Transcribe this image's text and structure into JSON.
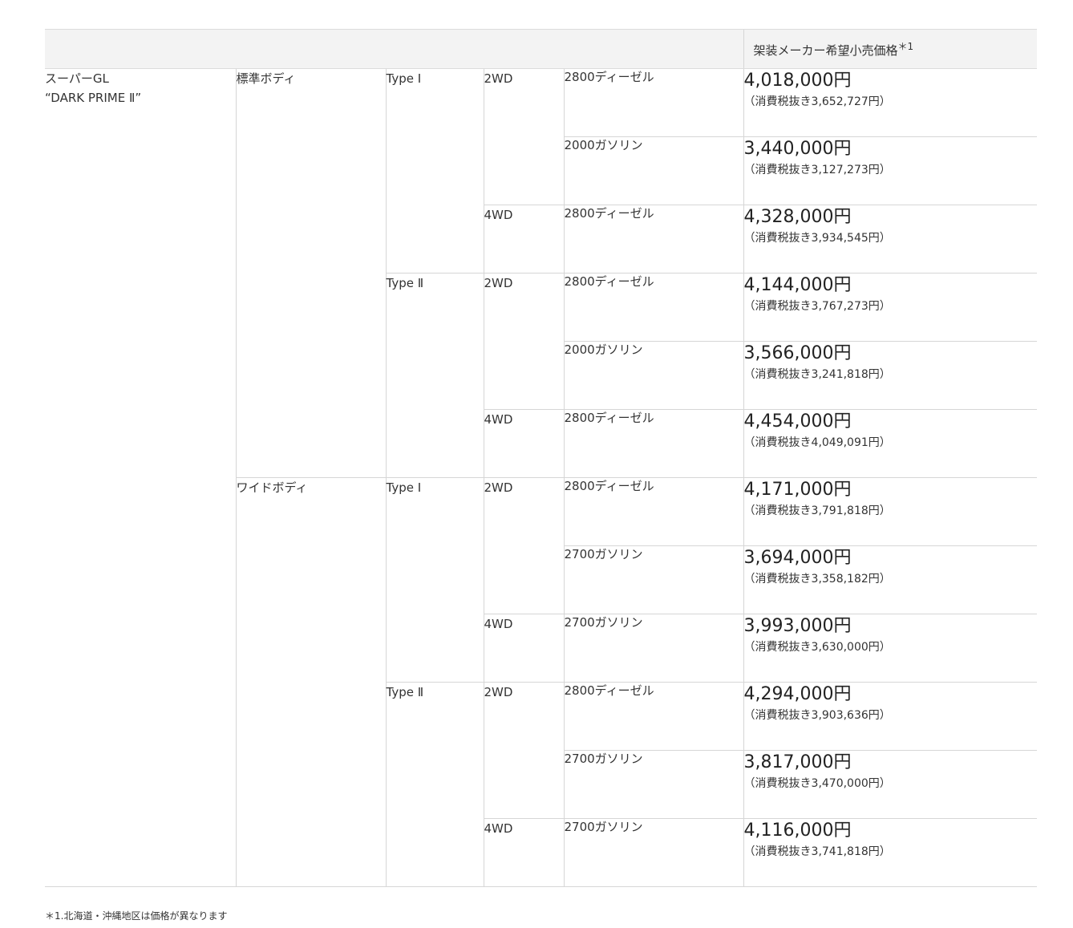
{
  "header": {
    "price_label": "架装メーカー希望小売価格",
    "price_mark": "＊1"
  },
  "model": {
    "name_line1": "スーパーGL",
    "name_line2": "“DARK PRIME Ⅱ”"
  },
  "bodies": [
    {
      "name": "標準ボディ",
      "types": [
        {
          "name": "Type Ⅰ",
          "drives": [
            {
              "name": "2WD",
              "rows": [
                {
                  "engine": "2800ディーゼル",
                  "price": "4,018,000円",
                  "price_ex": "（消費税抜き3,652,727円）"
                },
                {
                  "engine": "2000ガソリン",
                  "price": "3,440,000円",
                  "price_ex": "（消費税抜き3,127,273円）"
                }
              ]
            },
            {
              "name": "4WD",
              "rows": [
                {
                  "engine": "2800ディーゼル",
                  "price": "4,328,000円",
                  "price_ex": "（消費税抜き3,934,545円）"
                }
              ]
            }
          ]
        },
        {
          "name": "Type Ⅱ",
          "drives": [
            {
              "name": "2WD",
              "rows": [
                {
                  "engine": "2800ディーゼル",
                  "price": "4,144,000円",
                  "price_ex": "（消費税抜き3,767,273円）"
                },
                {
                  "engine": "2000ガソリン",
                  "price": "3,566,000円",
                  "price_ex": "（消費税抜き3,241,818円）"
                }
              ]
            },
            {
              "name": "4WD",
              "rows": [
                {
                  "engine": "2800ディーゼル",
                  "price": "4,454,000円",
                  "price_ex": "（消費税抜き4,049,091円）"
                }
              ]
            }
          ]
        }
      ]
    },
    {
      "name": "ワイドボディ",
      "types": [
        {
          "name": "Type Ⅰ",
          "drives": [
            {
              "name": "2WD",
              "rows": [
                {
                  "engine": "2800ディーゼル",
                  "price": "4,171,000円",
                  "price_ex": "（消費税抜き3,791,818円）"
                },
                {
                  "engine": "2700ガソリン",
                  "price": "3,694,000円",
                  "price_ex": "（消費税抜き3,358,182円）"
                }
              ]
            },
            {
              "name": "4WD",
              "rows": [
                {
                  "engine": "2700ガソリン",
                  "price": "3,993,000円",
                  "price_ex": "（消費税抜き3,630,000円）"
                }
              ]
            }
          ]
        },
        {
          "name": "Type Ⅱ",
          "drives": [
            {
              "name": "2WD",
              "rows": [
                {
                  "engine": "2800ディーゼル",
                  "price": "4,294,000円",
                  "price_ex": "（消費税抜き3,903,636円）"
                },
                {
                  "engine": "2700ガソリン",
                  "price": "3,817,000円",
                  "price_ex": "（消費税抜き3,470,000円）"
                }
              ]
            },
            {
              "name": "4WD",
              "rows": [
                {
                  "engine": "2700ガソリン",
                  "price": "4,116,000円",
                  "price_ex": "（消費税抜き3,741,818円）"
                }
              ]
            }
          ]
        }
      ]
    }
  ],
  "footnote": "＊1.北海道・沖縄地区は価格が異なります"
}
